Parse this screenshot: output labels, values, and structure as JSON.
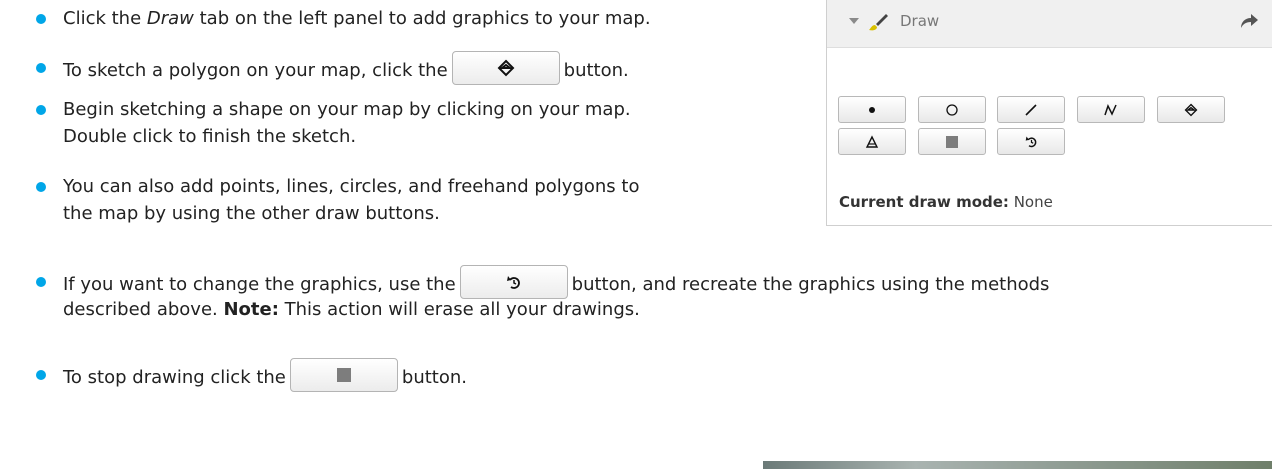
{
  "instructions": [
    {
      "before": "Click the ",
      "emphasis": "Draw",
      "after": " tab on the left panel to add graphics to your map."
    },
    {
      "before": "To sketch a polygon on your map, click the",
      "button_icon": "polygon-icon",
      "after": "button."
    },
    {
      "line1": "Begin sketching a shape on your map by clicking on your map.",
      "line2": "Double click to finish the sketch."
    },
    {
      "line1": "You can also add points, lines, circles, and freehand polygons to",
      "line2": "the map by using the other draw buttons."
    },
    {
      "before": "If you want to change the graphics, use the",
      "button_icon": "undo-icon",
      "after": "button, and recreate the graphics using the methods",
      "line2_before": "described above. ",
      "note_label": "Note:",
      "note_text": " This action will erase all your drawings."
    },
    {
      "before": "To stop drawing click the",
      "button_icon": "stop-icon",
      "after": "button."
    }
  ],
  "draw_panel": {
    "title": "Draw",
    "mode_label": "Current draw mode:",
    "mode_value": " None",
    "tools": [
      "point-icon",
      "circle-icon",
      "line-icon",
      "freehand-line-icon",
      "polygon-icon",
      "freehand-polygon-icon",
      "stop-icon",
      "undo-icon"
    ]
  },
  "colors": {
    "bullet": "#00a6e8",
    "text": "#222222",
    "panel_header": "#f0f0f0"
  }
}
